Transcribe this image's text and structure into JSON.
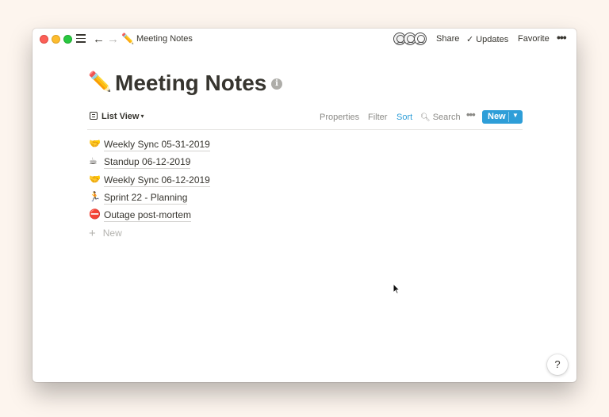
{
  "window": {
    "breadcrumb_emoji": "✏️",
    "breadcrumb_title": "Meeting Notes"
  },
  "topbar": {
    "share": "Share",
    "updates": "Updates",
    "favorite": "Favorite",
    "more": "•••"
  },
  "page": {
    "emoji": "✏️",
    "title": "Meeting Notes",
    "info_glyph": "i"
  },
  "toolbar": {
    "view_label": "List View",
    "properties": "Properties",
    "filter": "Filter",
    "sort": "Sort",
    "search": "Search",
    "more": "•••",
    "new_label": "New"
  },
  "items": [
    {
      "emoji": "🤝",
      "title": "Weekly Sync 05-31-2019"
    },
    {
      "emoji": "☕",
      "title": "Standup 06-12-2019"
    },
    {
      "emoji": "🤝",
      "title": "Weekly Sync 06-12-2019"
    },
    {
      "emoji": "🏃",
      "title": "Sprint 22 - Planning"
    },
    {
      "emoji": "⛔",
      "title": "Outage post-mortem"
    }
  ],
  "add_new": "New",
  "help": "?",
  "colors": {
    "accent": "#2e9ed8",
    "text": "#37352f",
    "muted": "#8b8a86",
    "background": "#fdf5ee"
  }
}
